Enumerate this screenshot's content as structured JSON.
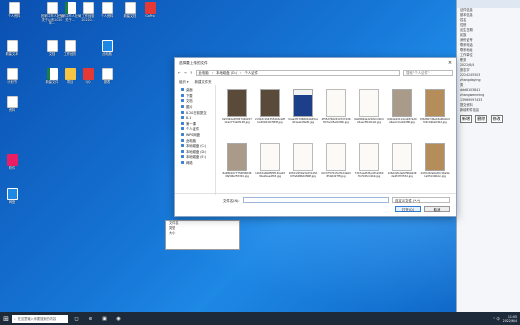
{
  "desktop": {
    "icons": [
      {
        "label": "个人资料",
        "kind": "ic-doc"
      },
      {
        "label": "张家口市人社局关于公布2020年...",
        "kind": "ic-doc"
      },
      {
        "label": "三家口市人社局关于...",
        "kind": "ic-xls"
      },
      {
        "label": "工作经验20220...",
        "kind": "ic-doc"
      },
      {
        "label": "个人资料",
        "kind": "ic-doc"
      },
      {
        "label": "新建文档",
        "kind": "ic-doc"
      },
      {
        "label": "GoPro",
        "kind": "ic-red"
      },
      {
        "label": "新建文本",
        "kind": "ic-doc"
      },
      {
        "label": "文档",
        "kind": "ic-doc"
      },
      {
        "label": "工作经历",
        "kind": "ic-doc"
      },
      {
        "label": "此电脑",
        "kind": "ic-blu"
      },
      {
        "label": "计划书",
        "kind": "ic-doc"
      },
      {
        "label": "新建文件",
        "kind": "ic-xls"
      },
      {
        "label": "项目",
        "kind": "ic-fold"
      },
      {
        "label": "QQ",
        "kind": "ic-red"
      },
      {
        "label": "报表",
        "kind": "ic-doc"
      },
      {
        "label": "资料",
        "kind": "ic-doc"
      },
      {
        "label": "软件",
        "kind": "ic-pnk"
      },
      {
        "label": "网盘",
        "kind": "ic-blu"
      }
    ]
  },
  "dialog": {
    "title": "选择要上传的文件",
    "close": "×",
    "path": [
      "此电脑",
      "本地磁盘 (D:)",
      "个人证件"
    ],
    "search_placeholder": "搜索\"个人证件\"",
    "toolbar": {
      "organize": "组织 ▾",
      "new_folder": "新建文件夹"
    },
    "nav_items": [
      {
        "label": "桌面"
      },
      {
        "label": "下载"
      },
      {
        "label": "文档"
      },
      {
        "label": "图片"
      },
      {
        "label": "8.20日前提交"
      },
      {
        "label": "8.1"
      },
      {
        "label": "第一课"
      },
      {
        "label": "个人证件"
      },
      {
        "label": "WPS网盘"
      },
      {
        "label": "此电脑"
      },
      {
        "label": "本地磁盘 (C:)"
      },
      {
        "label": "本地磁盘 (D:)"
      },
      {
        "label": "本地磁盘 (E:)"
      },
      {
        "label": "网络"
      }
    ],
    "files": [
      {
        "name": "0a5364a3f9f2742620712e277da0f148.jpg",
        "style": "dark"
      },
      {
        "name": "2c9b3c10435540bce8fba3026d0cf9f4f.jpg",
        "style": "dark"
      },
      {
        "name": "3ceadf179686b1645ce4d1eabd9ef0.jpg",
        "style": "pic"
      },
      {
        "name": "4f55d76624107274468d7ac05a9c80b.jpg",
        "style": "cert"
      },
      {
        "name": "6ad8944e12022c22b4a5aec8540ce0.jpg",
        "style": "cert"
      },
      {
        "name": "6dbde4d114ca287ad0a6acb3ca044f6f.jpg",
        "style": "mid"
      },
      {
        "name": "6fb2807d6e43a9fe1b0f29cb9be0d0d.jpg",
        "style": "gold"
      },
      {
        "name": "8e98b0277756f98d46dfa59b255391.jpg",
        "style": "mid"
      },
      {
        "name": "11b67e6b85f6f13ba4930e2bee4f03.jpg",
        "style": "cert"
      },
      {
        "name": "20fdc2059a3e33145d67fe6986d4f96f.jpg",
        "style": "cert"
      },
      {
        "name": "62c075701fc2f1dda6d8546d27f8.jpg",
        "style": "cert"
      },
      {
        "name": "7347ae4fd5ad31a5607b7b95cc6b9.jpg",
        "style": "cert"
      },
      {
        "name": "126dd2bde02f96a9d9de4fd7f255d.jpg",
        "style": "cert"
      },
      {
        "name": "2470c62a6ad0c16a9a1e5fdc40bbc.jpg",
        "style": "gold"
      }
    ],
    "file_name_label": "文件名(N):",
    "file_name_value": "",
    "file_type": "自定义文件 (*.*)",
    "open_button": "打开(O)",
    "cancel_button": "取消"
  },
  "browser": {
    "lines": [
      {
        "text": "",
        "blue": true
      },
      {
        "text": "证件信息"
      },
      {
        "text": "基本信息"
      },
      {
        "text": "姓名"
      },
      {
        "text": "性别"
      },
      {
        "text": "出生日期"
      },
      {
        "text": "民族"
      },
      {
        "text": "身份证号"
      },
      {
        "text": "联系电话"
      },
      {
        "text": "联系地址"
      },
      {
        "text": "工作单位"
      },
      {
        "text": "职务"
      },
      {
        "text": "2022/6/4"
      },
      {
        "text": "张志宇"
      },
      {
        "text": "2224245503"
      },
      {
        "text": "zhangdaying"
      },
      {
        "text": "男"
      },
      {
        "text": "ddd8103841"
      },
      {
        "text": "zhangwenming"
      },
      {
        "text": "13969597433"
      },
      {
        "text": "提交资料"
      },
      {
        "text": "新增附件信息"
      }
    ],
    "buttons": [
      "新增",
      "删除",
      "修改"
    ]
  },
  "left_panel": {
    "lines": [
      "文件名",
      "类型",
      "大小"
    ]
  },
  "taskbar": {
    "start": "⊞",
    "search": "在这里输入你要搜索的内容",
    "apps": [
      "◻",
      "e",
      "▣",
      "◉"
    ],
    "tray": "^ 中",
    "time": "11:05",
    "date": "2022/6/4"
  }
}
